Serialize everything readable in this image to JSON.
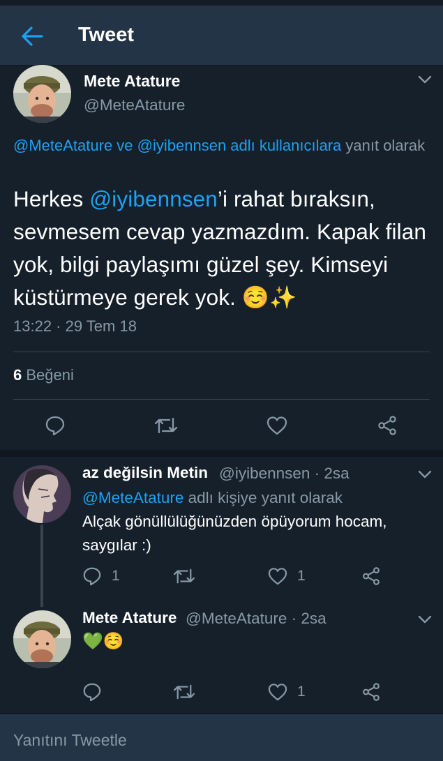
{
  "header": {
    "title": "Tweet"
  },
  "main_tweet": {
    "name": "Mete Atature",
    "handle": "@MeteAtature",
    "reply_to": {
      "mention1": "@MeteAtature",
      "conj": " ve ",
      "mention2": "@iyibennsen",
      "suffix_link": " adlı kullanıcılara",
      "suffix_text": " yanıt olarak"
    },
    "text": {
      "part1": "Herkes ",
      "mention": "@iyibennsen",
      "part2": "’i rahat bıraksın, sevmesem cevap yazmazdım. Kapak filan yok, bilgi paylaşımı güzel şey. Kimseyi küstürmeye gerek yok. ",
      "emoji": "☺️✨"
    },
    "timestamp": "13:22 · 29 Tem 18",
    "likes_count": "6",
    "likes_label": " Beğeni"
  },
  "replies": [
    {
      "name": "az değilsin Metin",
      "handle": "@iyibennsen · 2sa",
      "reply_to": {
        "mention": "@MeteAtature",
        "suffix": " adlı kişiye yanıt olarak"
      },
      "text": "Alçak gönüllülüğünüzden öpüyorum hocam, saygılar :)",
      "reply_count": "1",
      "retweet_count": "",
      "like_count": "1"
    },
    {
      "name": "Mete Atature",
      "handle": "@MeteAtature · 2sa",
      "text": "💚☺️",
      "reply_count": "",
      "retweet_count": "",
      "like_count": "1"
    }
  ],
  "compose": {
    "placeholder": "Yanıtını Tweetle"
  },
  "colors": {
    "background": "#15202b",
    "header": "#243447",
    "accent": "#1da1f2",
    "muted": "#8899a6",
    "divider": "#38444d"
  },
  "icons": [
    "back-arrow-icon",
    "chevron-down-icon",
    "reply-icon",
    "retweet-icon",
    "like-icon",
    "share-icon"
  ]
}
